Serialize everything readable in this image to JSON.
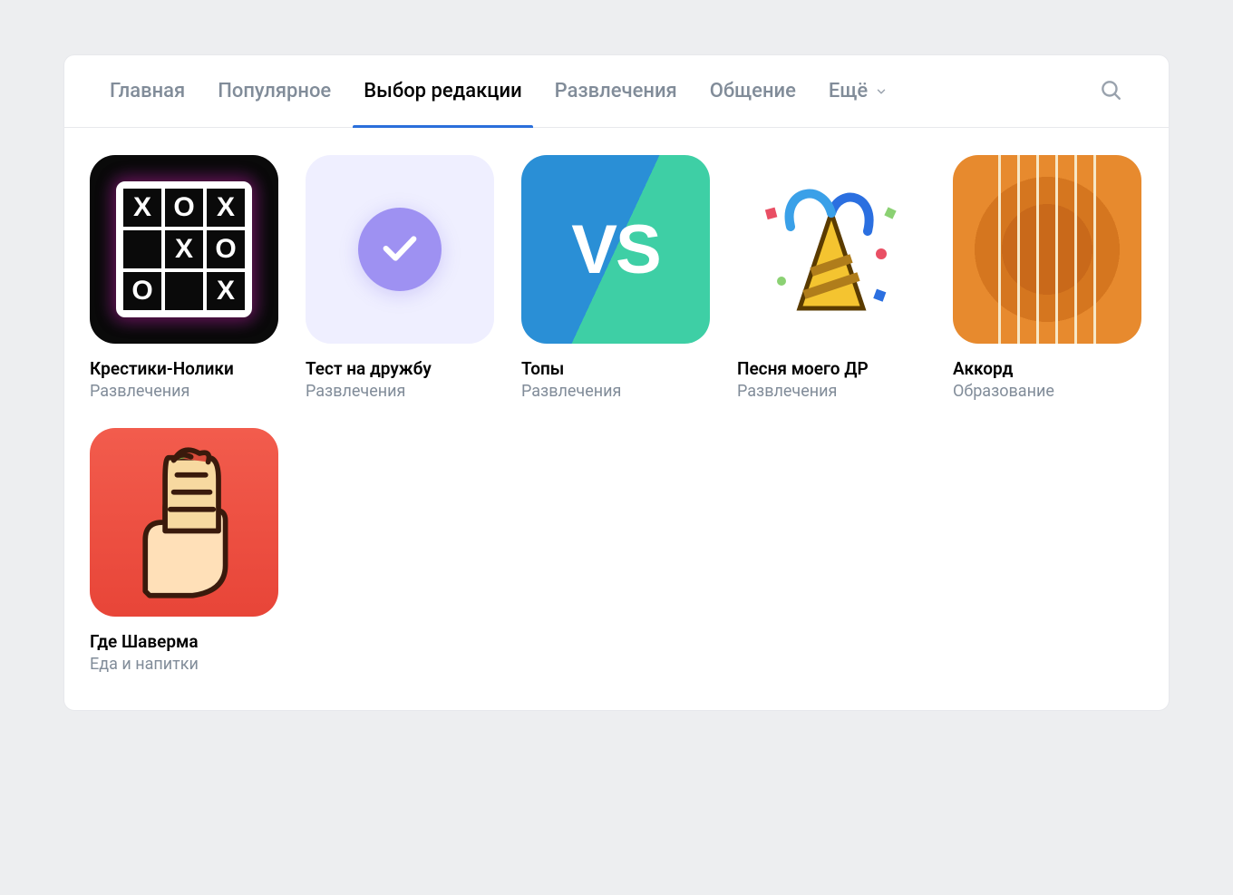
{
  "tabs": {
    "items": [
      {
        "label": "Главная",
        "active": false
      },
      {
        "label": "Популярное",
        "active": false
      },
      {
        "label": "Выбор редакции",
        "active": true
      },
      {
        "label": "Развлечения",
        "active": false
      },
      {
        "label": "Общение",
        "active": false
      },
      {
        "label": "Ещё",
        "active": false,
        "has_chevron": true
      }
    ]
  },
  "apps": [
    {
      "title": "Крестики-Нолики",
      "category": "Развлечения",
      "icon_kind": "tictactoe"
    },
    {
      "title": "Тест на дружбу",
      "category": "Развлечения",
      "icon_kind": "check"
    },
    {
      "title": "Топы",
      "category": "Развлечения",
      "icon_kind": "vs"
    },
    {
      "title": "Песня моего ДР",
      "category": "Развлечения",
      "icon_kind": "bday"
    },
    {
      "title": "Аккорд",
      "category": "Образование",
      "icon_kind": "chord"
    },
    {
      "title": "Где Шаверма",
      "category": "Еда и напитки",
      "icon_kind": "shawarma"
    }
  ]
}
